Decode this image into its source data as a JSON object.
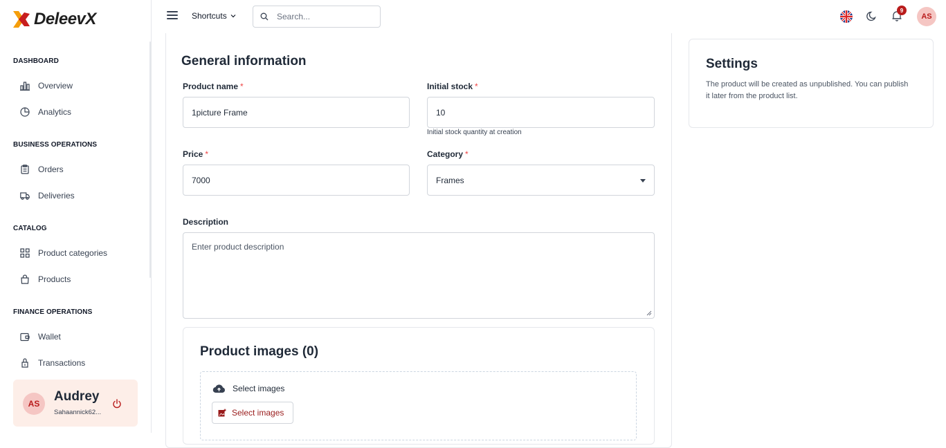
{
  "brand": {
    "name": "DeleevX"
  },
  "sidebar": {
    "sections": [
      {
        "title": "DASHBOARD",
        "items": [
          {
            "label": "Overview",
            "icon": "bar-chart-icon"
          },
          {
            "label": "Analytics",
            "icon": "pie-chart-icon"
          }
        ]
      },
      {
        "title": "BUSINESS OPERATIONS",
        "items": [
          {
            "label": "Orders",
            "icon": "clipboard-icon"
          },
          {
            "label": "Deliveries",
            "icon": "truck-icon"
          }
        ]
      },
      {
        "title": "CATALOG",
        "items": [
          {
            "label": "Product categories",
            "icon": "grid-icon"
          },
          {
            "label": "Products",
            "icon": "shopping-bag-icon"
          }
        ]
      },
      {
        "title": "FINANCE OPERATIONS",
        "items": [
          {
            "label": "Wallet",
            "icon": "wallet-icon"
          },
          {
            "label": "Transactions",
            "icon": "transactions-icon"
          }
        ]
      }
    ],
    "user": {
      "initials": "AS",
      "name": "Audrey",
      "email": "Sahaannick62..."
    }
  },
  "topbar": {
    "shortcuts_label": "Shortcuts",
    "search_placeholder": "Search...",
    "notification_count": "9",
    "avatar_initials": "AS"
  },
  "form": {
    "title": "General information",
    "product_name": {
      "label": "Product name",
      "value": "1picture Frame"
    },
    "initial_stock": {
      "label": "Initial stock",
      "value": "10",
      "helper": "Initial stock quantity at creation"
    },
    "price": {
      "label": "Price",
      "value": "7000"
    },
    "category": {
      "label": "Category",
      "value": "Frames"
    },
    "description": {
      "label": "Description",
      "placeholder": "Enter product description"
    },
    "required_mark": "*"
  },
  "images": {
    "title": "Product images (0)",
    "select_label": "Select images",
    "button_label": "Select images"
  },
  "settings": {
    "title": "Settings",
    "text": "The product will be created as unpublished. You can publish it later from the product list."
  },
  "colors": {
    "accent": "#b91c1c",
    "user_card_bg": "#fdeee8",
    "avatar_bg": "#f5c6c3"
  }
}
